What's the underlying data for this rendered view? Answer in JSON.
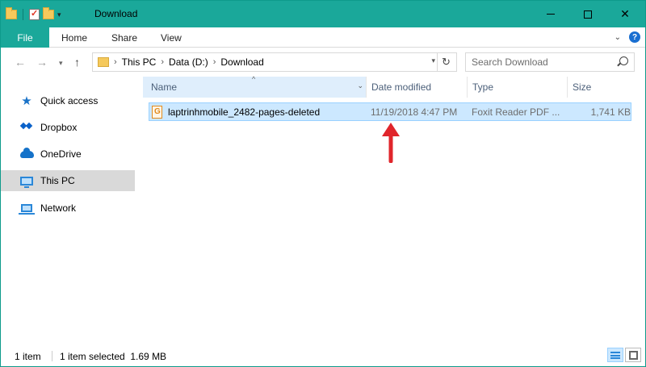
{
  "window": {
    "title": "Download",
    "accent_color": "#1aa89a"
  },
  "ribbon": {
    "file_tab": "File",
    "tabs": [
      "Home",
      "Share",
      "View"
    ],
    "help_label": "?"
  },
  "address": {
    "crumbs": [
      "This PC",
      "Data (D:)",
      "Download"
    ]
  },
  "search": {
    "placeholder": "Search Download"
  },
  "nav_pane": {
    "items": [
      {
        "label": "Quick access",
        "icon": "star-icon"
      },
      {
        "label": "Dropbox",
        "icon": "dropbox-icon"
      },
      {
        "label": "OneDrive",
        "icon": "onedrive-cloud-icon"
      },
      {
        "label": "This PC",
        "icon": "computer-icon",
        "selected": true
      },
      {
        "label": "Network",
        "icon": "network-icon"
      }
    ]
  },
  "file_list": {
    "columns": [
      "Name",
      "Date modified",
      "Type",
      "Size"
    ],
    "rows": [
      {
        "name": "laptrinhmobile_2482-pages-deleted",
        "date_modified": "11/19/2018 4:47 PM",
        "type": "Foxit Reader PDF ...",
        "size": "1,741 KB",
        "icon": "foxit-pdf-icon",
        "selected": true
      }
    ]
  },
  "status_bar": {
    "item_count": "1 item",
    "selection": "1 item selected  1.69 MB"
  },
  "annotation": {
    "arrow_color": "#e0252b"
  }
}
